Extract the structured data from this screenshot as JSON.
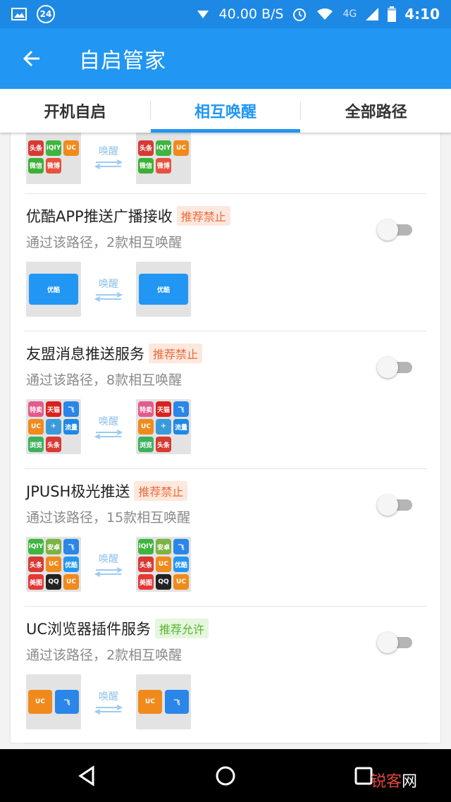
{
  "status_bar": {
    "notification_count": "24",
    "net_speed": "40.00 B/S",
    "network_type": "4G",
    "time": "4:10"
  },
  "app_bar": {
    "title": "自启管家"
  },
  "tabs": [
    {
      "label": "开机自启",
      "active": false
    },
    {
      "label": "相互唤醒",
      "active": true
    },
    {
      "label": "全部路径",
      "active": false
    }
  ],
  "wake_label": "唤醒",
  "app_icons": {
    "toutiao": {
      "label": "头条",
      "color": "#d63a33"
    },
    "iqiyi": {
      "label": "iQIY",
      "color": "#3fb53f"
    },
    "uc": {
      "label": "UC",
      "color": "#f08a1c"
    },
    "wechat": {
      "label": "微信",
      "color": "#3cb034"
    },
    "weibo": {
      "label": "微博",
      "color": "#e6523d"
    },
    "youku": {
      "label": "优酷",
      "color": "#2196f3"
    },
    "sale": {
      "label": "特卖",
      "color": "#e45a8c"
    },
    "tmall": {
      "label": "天猫",
      "color": "#d8221d"
    },
    "feiniu": {
      "label": "飞",
      "color": "#2a86e8"
    },
    "paper": {
      "label": "✈",
      "color": "#3a9bdc"
    },
    "liuliang": {
      "label": "流量",
      "color": "#1e88e5"
    },
    "liulan": {
      "label": "浏览",
      "color": "#3db05d"
    },
    "android": {
      "label": "安卓",
      "color": "#7cb342"
    },
    "xiuxiu": {
      "label": "美图",
      "color": "#e53935"
    },
    "qq": {
      "label": "QQ",
      "color": "#222222"
    }
  },
  "items": [
    {
      "partial": true,
      "source": [
        "toutiao",
        "iqiyi",
        "uc",
        "wechat",
        "weibo"
      ],
      "target": [
        "toutiao",
        "iqiyi",
        "uc",
        "wechat",
        "weibo"
      ]
    },
    {
      "title": "优酷APP推送广播接收",
      "badge": "推荐禁止",
      "badge_type": "forbid",
      "subtitle": "通过该路径，2款相互唤醒",
      "enabled": false,
      "layout": "one",
      "source": [
        "youku"
      ],
      "target": [
        "youku"
      ]
    },
    {
      "title": "友盟消息推送服务",
      "badge": "推荐禁止",
      "badge_type": "forbid",
      "subtitle": "通过该路径，8款相互唤醒",
      "enabled": false,
      "source": [
        "sale",
        "tmall",
        "feiniu",
        "uc",
        "paper",
        "liuliang",
        "liulan",
        "toutiao"
      ],
      "target": [
        "sale",
        "tmall",
        "feiniu",
        "uc",
        "paper",
        "liuliang",
        "liulan",
        "toutiao"
      ]
    },
    {
      "title": "JPUSH极光推送",
      "badge": "推荐禁止",
      "badge_type": "forbid",
      "subtitle": "通过该路径，15款相互唤醒",
      "enabled": false,
      "source": [
        "iqiyi",
        "android",
        "feiniu",
        "toutiao",
        "uc",
        "youku",
        "xiuxiu",
        "qq",
        "uc"
      ],
      "target": [
        "iqiyi",
        "android",
        "feiniu",
        "toutiao",
        "uc",
        "youku",
        "xiuxiu",
        "qq",
        "uc"
      ]
    },
    {
      "title": "UC浏览器插件服务",
      "badge": "推荐允许",
      "badge_type": "allow",
      "subtitle": "通过该路径，2款相互唤醒",
      "enabled": false,
      "layout": "two",
      "source": [
        "uc",
        "feiniu"
      ],
      "target": [
        "uc",
        "feiniu"
      ]
    }
  ],
  "watermark": {
    "part1": "锐客",
    "part2": "网"
  }
}
